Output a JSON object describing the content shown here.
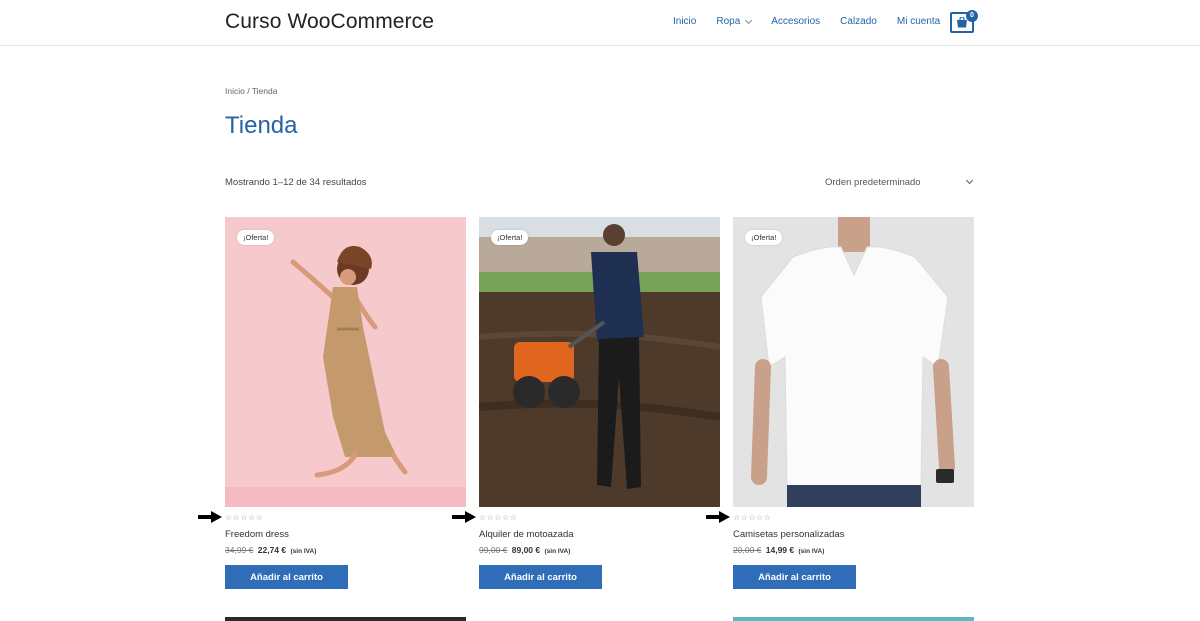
{
  "header": {
    "site_title": "Curso WooCommerce",
    "nav": [
      {
        "label": "Inicio",
        "dropdown": false
      },
      {
        "label": "Ropa",
        "dropdown": true
      },
      {
        "label": "Accesorios",
        "dropdown": false
      },
      {
        "label": "Calzado",
        "dropdown": false
      },
      {
        "label": "Mi cuenta",
        "dropdown": false
      }
    ],
    "cart_count": "0",
    "accent_color": "#2563a8"
  },
  "breadcrumb": "Inicio / Tienda",
  "page_title": "Tienda",
  "toolbar": {
    "result_count": "Mostrando 1–12 de 34 resultados",
    "ordering_selected": "Orden predeterminado"
  },
  "products": [
    {
      "badge": "¡Oferta!",
      "rating": "☆☆☆☆☆",
      "name": "Freedom dress",
      "old_price": "34,99 €",
      "new_price": "22,74 €",
      "tax_note": "(sin IVA)",
      "button": "Añadir al carrito"
    },
    {
      "badge": "¡Oferta!",
      "rating": "☆☆☆☆☆",
      "name": "Alquiler de motoazada",
      "old_price": "99,00 €",
      "new_price": "89,00 €",
      "tax_note": "(sin IVA)",
      "button": "Añadir al carrito"
    },
    {
      "badge": "¡Oferta!",
      "rating": "☆☆☆☆☆",
      "name": "Camisetas personalizadas",
      "old_price": "20,00 €",
      "new_price": "14,99 €",
      "tax_note": "(sin IVA)",
      "button": "Añadir al carrito"
    }
  ]
}
